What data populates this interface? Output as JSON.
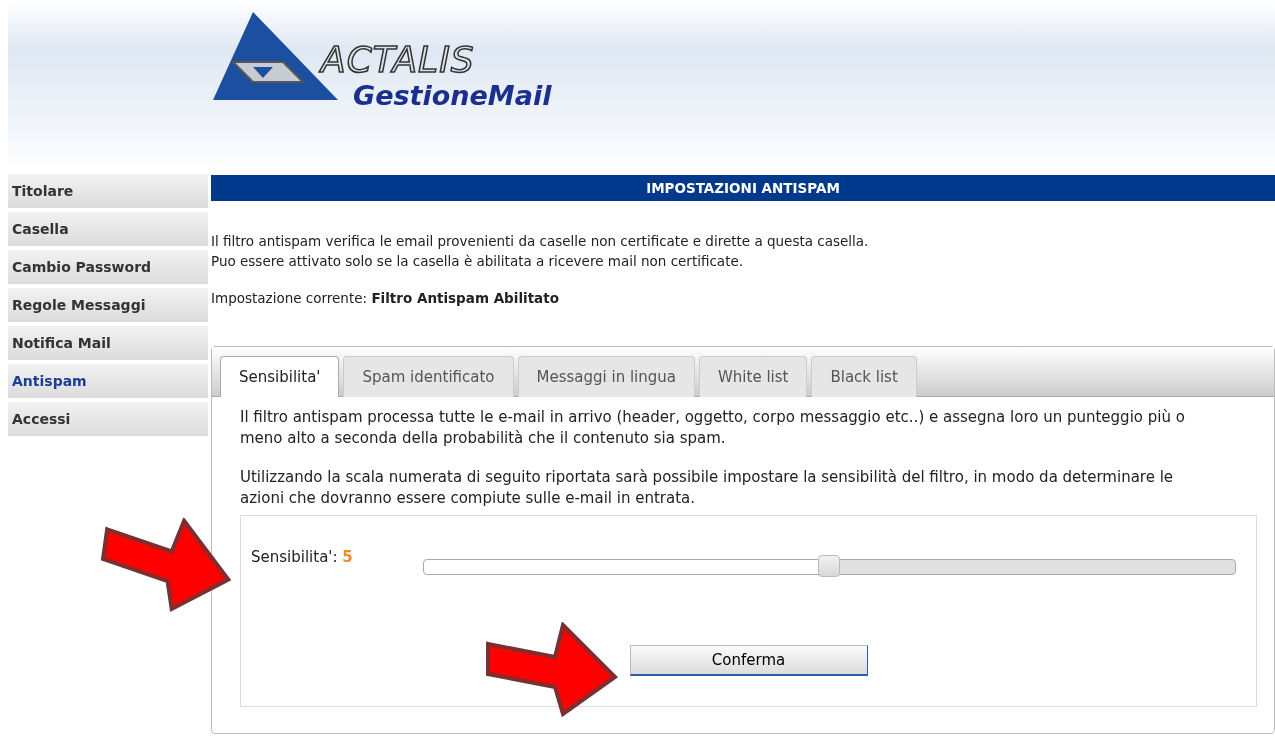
{
  "logo": {
    "brand": "ACTALIS",
    "product": "GestioneMail"
  },
  "sidebar": {
    "items": [
      {
        "label": "Titolare",
        "selected": false
      },
      {
        "label": "Casella",
        "selected": false
      },
      {
        "label": "Cambio Password",
        "selected": false
      },
      {
        "label": "Regole Messaggi",
        "selected": false
      },
      {
        "label": "Notifica Mail",
        "selected": false
      },
      {
        "label": "Antispam",
        "selected": true
      },
      {
        "label": "Accessi",
        "selected": false
      }
    ]
  },
  "title": "IMPOSTAZIONI ANTISPAM",
  "intro": [
    "Il filtro antispam verifica le email provenienti da caselle non certificate e dirette a questa casella.",
    "Puo essere attivato solo se la casella è abilitata a ricevere mail non certificate."
  ],
  "current_setting": {
    "label": "Impostazione corrente:",
    "value": "Filtro Antispam Abilitato"
  },
  "tabs": [
    {
      "label": "Sensibilita'",
      "selected": true
    },
    {
      "label": "Spam identificato",
      "selected": false
    },
    {
      "label": "Messaggi in lingua",
      "selected": false
    },
    {
      "label": "White list",
      "selected": false
    },
    {
      "label": "Black list",
      "selected": false
    }
  ],
  "paragraphs": [
    "Il filtro antispam processa tutte le e-mail in arrivo (header, oggetto, corpo messaggio etc..) e assegna loro un punteggio più o meno alto a seconda della probabilità che il contenuto sia spam.",
    "Utilizzando la scala numerata di seguito riportata sarà possibile impostare la sensibilità del filtro, in modo da determinare le azioni che dovranno essere compiute sulle e-mail in entrata."
  ],
  "sensitivity": {
    "label": "Sensibilita':",
    "value": "5",
    "level": 0.5
  },
  "buttons": [
    "Conferma"
  ]
}
